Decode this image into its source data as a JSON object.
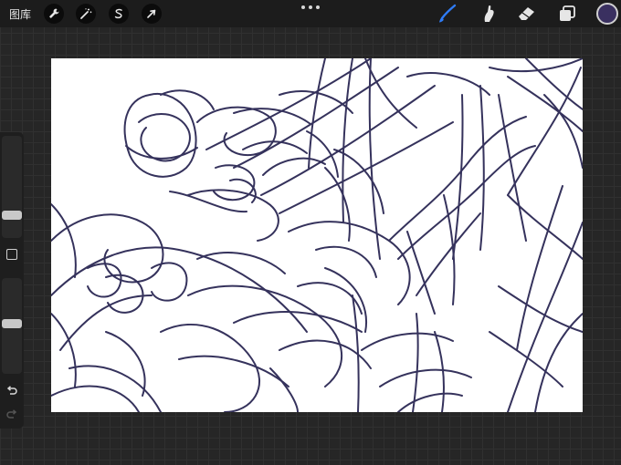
{
  "topbar": {
    "gallery_label": "图库",
    "tools_left": [
      {
        "name": "actions",
        "icon": "wrench-icon"
      },
      {
        "name": "adjustments",
        "icon": "magic-wand-icon"
      },
      {
        "name": "selection",
        "icon": "selection-s-icon"
      },
      {
        "name": "transform",
        "icon": "arrow-cursor-icon"
      }
    ],
    "tools_right": [
      {
        "name": "brush",
        "icon": "brush-icon",
        "active": true
      },
      {
        "name": "smudge",
        "icon": "smudge-icon",
        "active": false
      },
      {
        "name": "eraser",
        "icon": "eraser-icon",
        "active": false
      },
      {
        "name": "layers",
        "icon": "layers-icon",
        "active": false
      }
    ],
    "current_color": "#3a3060"
  },
  "sidebar": {
    "brush_size_icon": "slider-thumb",
    "opacity_icon": "slider-thumb",
    "modify_icon": "square-icon",
    "undo_icon": "undo-arrow-icon",
    "redo_icon": "redo-arrow-icon"
  },
  "canvas": {
    "background": "#ffffff",
    "stroke_color": "#35325c"
  },
  "colors": {
    "accent_blue": "#2f7cf6",
    "toolbar_bg": "#1c1c1c"
  }
}
